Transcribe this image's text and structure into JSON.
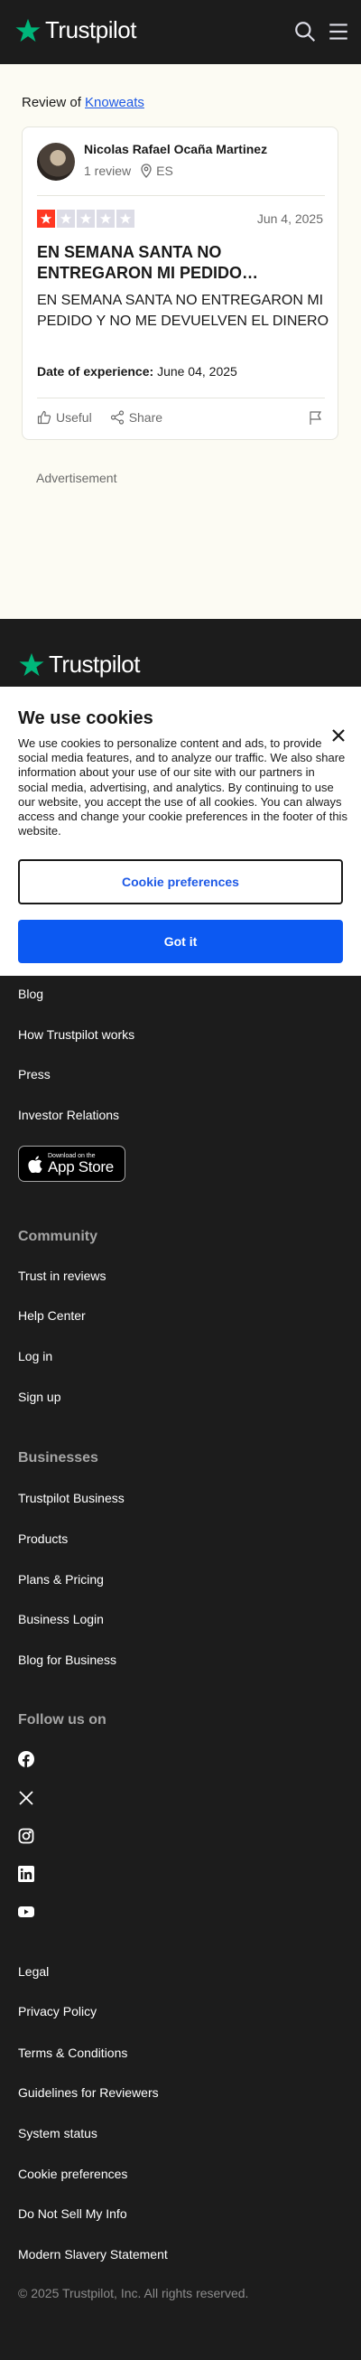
{
  "header": {
    "logo_text": "Trustpilot",
    "search_icon": "search-icon",
    "menu_icon": "hamburger-menu-icon"
  },
  "review_page": {
    "review_of_prefix": "Review of",
    "company_name": "Knoweats",
    "reviewer": {
      "name": "Nicolas Rafael Ocaña Martinez",
      "review_count": "1 review",
      "country": "ES"
    },
    "rating": 1,
    "rating_max": 5,
    "date": "Jun 4, 2025",
    "title": "EN SEMANA SANTA NO ENTREGARON MI PEDIDO…",
    "body": "EN SEMANA SANTA NO ENTREGARON MI PEDIDO Y NO ME DEVUELVEN EL DINERO",
    "experience_label": "Date of experience:",
    "experience_date": "June 04, 2025",
    "actions": {
      "useful": "Useful",
      "share": "Share"
    },
    "advertisement_label": "Advertisement"
  },
  "cookie_banner": {
    "title": "We use cookies",
    "text": "We use cookies to personalize content and ads, to provide social media features, and to analyze our traffic. We also share information about your use of our site with our partners in social media, advertising, and analytics. By continuing to use our website, you accept the use of all cookies. You can always access and change your cookie preferences in the footer of this website.",
    "preferences_button": "Cookie preferences",
    "accept_button": "Got it"
  },
  "footer": {
    "logo_text": "Trustpilot",
    "about_links": [
      "Blog",
      "How Trustpilot works",
      "Press",
      "Investor Relations"
    ],
    "app_store": {
      "small": "Download on the",
      "big": "App Store"
    },
    "community_heading": "Community",
    "community_links": [
      "Trust in reviews",
      "Help Center",
      "Log in",
      "Sign up"
    ],
    "businesses_heading": "Businesses",
    "businesses_links": [
      "Trustpilot Business",
      "Products",
      "Plans & Pricing",
      "Business Login",
      "Blog for Business"
    ],
    "follow_heading": "Follow us on",
    "social_icons": [
      "facebook-icon",
      "x-twitter-icon",
      "instagram-icon",
      "linkedin-icon",
      "youtube-icon"
    ],
    "legal_links": [
      "Legal",
      "Privacy Policy",
      "Terms & Conditions",
      "Guidelines for Reviewers",
      "System status",
      "Cookie preferences",
      "Do Not Sell My Info",
      "Modern Slavery Statement"
    ],
    "copyright": "© 2025 Trustpilot, Inc. All rights reserved."
  },
  "colors": {
    "brand_green": "#00b67a",
    "star_red": "#ff3722",
    "link_blue": "#1c58e6",
    "button_blue": "#0c59f2",
    "footer_bg": "#1c1c1c",
    "page_bg": "#fcfbf3"
  }
}
